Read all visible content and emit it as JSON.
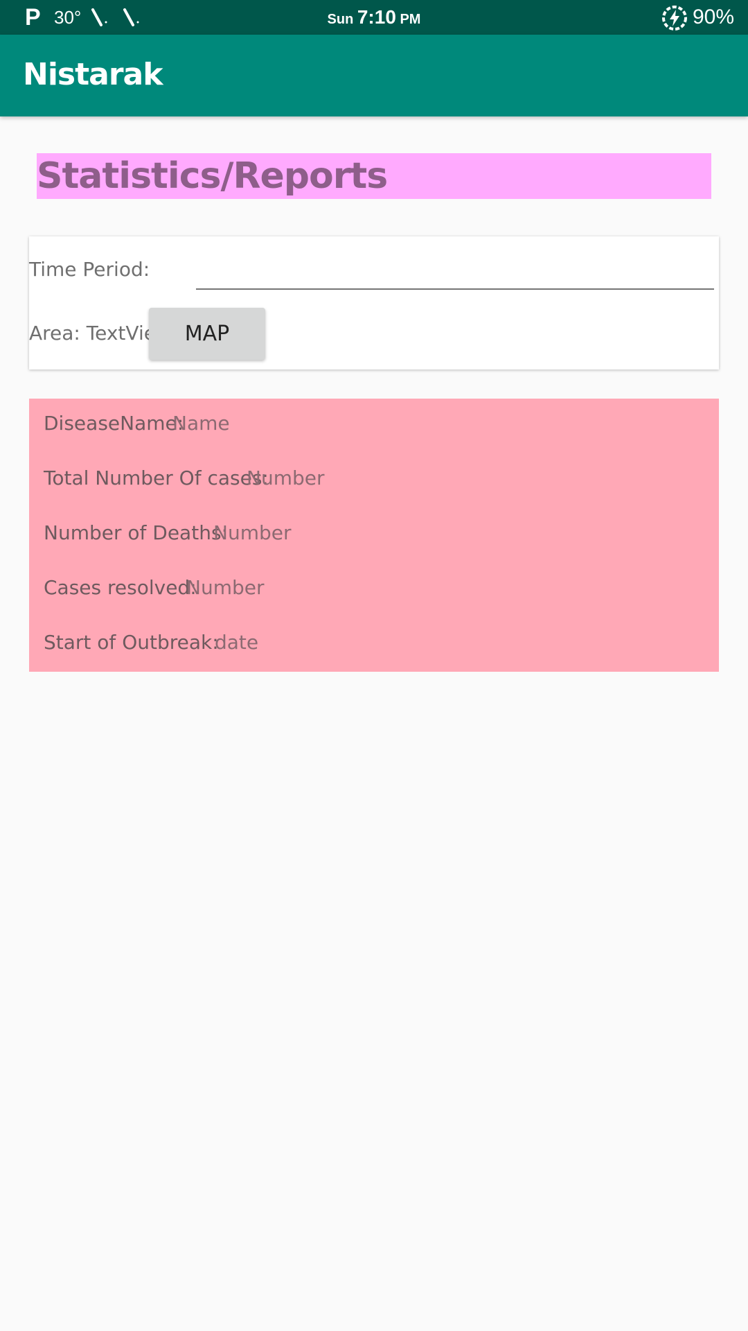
{
  "status_bar": {
    "carrier_icon": "P",
    "temperature": "30°",
    "day": "Sun",
    "time": "7:10",
    "ampm": "PM",
    "battery": "90%"
  },
  "app_bar": {
    "title": "Nistarak"
  },
  "page": {
    "heading": "Statistics/Reports"
  },
  "filters": {
    "time_period_label": "Time Period:",
    "time_period_value": "",
    "area_label": "Area: TextView",
    "map_button": "MAP"
  },
  "stats": {
    "disease_label": "DiseaseName:",
    "disease_value": "Name",
    "total_label": "Total Number Of cases:",
    "total_value": "Number",
    "deaths_label": "Number of Deaths:",
    "deaths_value": "Number",
    "resolved_label": "Cases resolved:",
    "resolved_value": "Number",
    "outbreak_label": "Start of Outbreak:",
    "outbreak_value": "date"
  },
  "colors": {
    "status_bar": "#00574b",
    "app_bar": "#00897b",
    "heading_bg": "#ffaafe",
    "stats_bg": "#ffa8b6"
  }
}
